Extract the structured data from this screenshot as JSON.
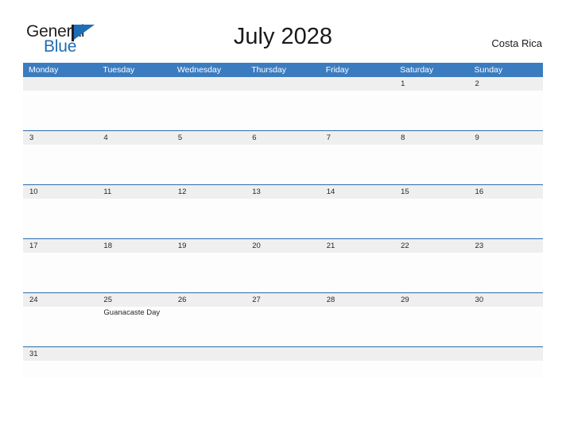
{
  "brand": {
    "name_part1": "General",
    "name_part2": "Blue",
    "flag_icon": "triangle-flag-icon",
    "color_primary": "#1f6db5",
    "color_text": "#231f20"
  },
  "header": {
    "title": "July 2028",
    "region": "Costa Rica"
  },
  "calendar": {
    "header_bg": "#3b7cc0",
    "rule_color": "#2b6ca8",
    "daynum_bg": "#efefef",
    "weekdays": [
      "Monday",
      "Tuesday",
      "Wednesday",
      "Thursday",
      "Friday",
      "Saturday",
      "Sunday"
    ],
    "weeks": [
      {
        "days": [
          {
            "num": "",
            "events": []
          },
          {
            "num": "",
            "events": []
          },
          {
            "num": "",
            "events": []
          },
          {
            "num": "",
            "events": []
          },
          {
            "num": "",
            "events": []
          },
          {
            "num": "1",
            "events": []
          },
          {
            "num": "2",
            "events": []
          }
        ]
      },
      {
        "days": [
          {
            "num": "3",
            "events": []
          },
          {
            "num": "4",
            "events": []
          },
          {
            "num": "5",
            "events": []
          },
          {
            "num": "6",
            "events": []
          },
          {
            "num": "7",
            "events": []
          },
          {
            "num": "8",
            "events": []
          },
          {
            "num": "9",
            "events": []
          }
        ]
      },
      {
        "days": [
          {
            "num": "10",
            "events": []
          },
          {
            "num": "11",
            "events": []
          },
          {
            "num": "12",
            "events": []
          },
          {
            "num": "13",
            "events": []
          },
          {
            "num": "14",
            "events": []
          },
          {
            "num": "15",
            "events": []
          },
          {
            "num": "16",
            "events": []
          }
        ]
      },
      {
        "days": [
          {
            "num": "17",
            "events": []
          },
          {
            "num": "18",
            "events": []
          },
          {
            "num": "19",
            "events": []
          },
          {
            "num": "20",
            "events": []
          },
          {
            "num": "21",
            "events": []
          },
          {
            "num": "22",
            "events": []
          },
          {
            "num": "23",
            "events": []
          }
        ]
      },
      {
        "days": [
          {
            "num": "24",
            "events": []
          },
          {
            "num": "25",
            "events": [
              "Guanacaste Day"
            ]
          },
          {
            "num": "26",
            "events": []
          },
          {
            "num": "27",
            "events": []
          },
          {
            "num": "28",
            "events": []
          },
          {
            "num": "29",
            "events": []
          },
          {
            "num": "30",
            "events": []
          }
        ]
      },
      {
        "days": [
          {
            "num": "31",
            "events": []
          },
          {
            "num": "",
            "events": []
          },
          {
            "num": "",
            "events": []
          },
          {
            "num": "",
            "events": []
          },
          {
            "num": "",
            "events": []
          },
          {
            "num": "",
            "events": []
          },
          {
            "num": "",
            "events": []
          }
        ]
      }
    ]
  }
}
